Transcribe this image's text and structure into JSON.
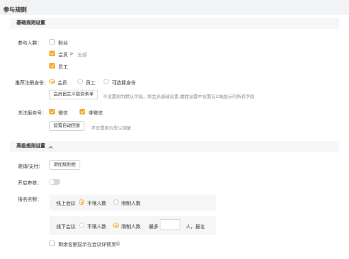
{
  "page_title": "参与规则",
  "basic": {
    "header": "基础规则设置",
    "participants": {
      "label": "参与人群：",
      "options": [
        {
          "label": "粉丝",
          "checked": false
        },
        {
          "label": "会员",
          "checked": true,
          "suffix": "全部"
        },
        {
          "label": "员工",
          "checked": true
        }
      ]
    },
    "recommend": {
      "label": "推荐注册身份：",
      "options": [
        {
          "label": "会员",
          "selected": true
        },
        {
          "label": "员工",
          "selected": false
        },
        {
          "label": "可选择身份",
          "selected": false
        }
      ],
      "form_button": "会员自定义留资表单",
      "form_hint": "不设置则为默认字段，即会员基础设置-属性设置中设置在C端显示的所有字段"
    },
    "follow": {
      "label": "关注服务号：",
      "options": [
        {
          "label": "微信",
          "checked": true
        },
        {
          "label": "非微信",
          "checked": true
        }
      ],
      "reply_button": "设置自动回复",
      "reply_hint": "不设置则为默认回复"
    }
  },
  "advanced": {
    "header": "高级规则设置",
    "invite": {
      "label": "邀请/支付：",
      "button": "添加规则组"
    },
    "review": {
      "label": "开启审核：",
      "enabled": false
    },
    "quota": {
      "label": "报名名额：",
      "online": {
        "label": "线上会议",
        "options": [
          {
            "label": "不限人数",
            "selected": true
          },
          {
            "label": "限制人数",
            "selected": false
          }
        ]
      },
      "offline": {
        "label": "线下会议",
        "options": [
          {
            "label": "不限人数",
            "selected": false
          },
          {
            "label": "限制人数",
            "selected": true
          }
        ],
        "max_prefix": "最多",
        "max_value": "",
        "max_suffix": "人，报名"
      },
      "show_remaining": {
        "label": "剩余名额显示在会议详情页",
        "checked": false
      }
    }
  },
  "colors": {
    "accent": "#f5a623",
    "section_bg": "#f5f6f7",
    "page_bg": "#f2f3f5"
  }
}
